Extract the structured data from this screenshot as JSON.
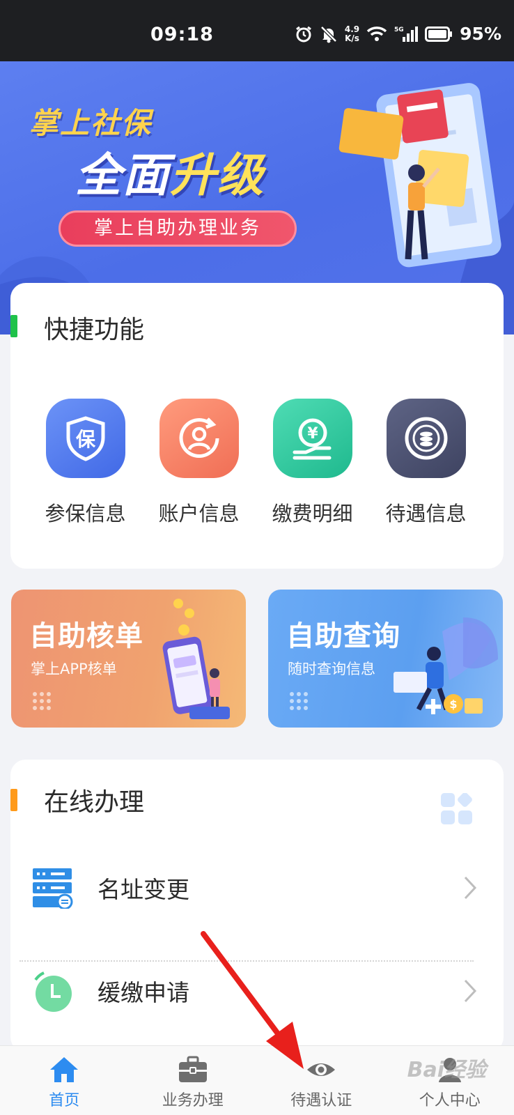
{
  "status_bar": {
    "time": "09:18",
    "net_speed_value": "4.9",
    "net_speed_unit": "K/s",
    "signal_type": "5G",
    "battery": "95%"
  },
  "banner": {
    "title_line1": "掌上社保",
    "title_line2_a": "全面",
    "title_line2_b": "升级",
    "pill": "掌上自助办理业务"
  },
  "quick": {
    "title": "快捷功能",
    "accent_color": "#1fc24a",
    "items": [
      {
        "label": "参保信息",
        "icon": "shield-bao-icon",
        "glyph": "保",
        "color": "#4f7cf0"
      },
      {
        "label": "账户信息",
        "icon": "account-refresh-icon",
        "color": "#f5866a"
      },
      {
        "label": "缴费明细",
        "icon": "yuan-hand-icon",
        "color": "#2fc8a0"
      },
      {
        "label": "待遇信息",
        "icon": "coin-stack-icon",
        "color": "#4a506e"
      }
    ]
  },
  "promos": {
    "left": {
      "title": "自助核单",
      "subtitle": "掌上APP核单",
      "color": "#ef9a72"
    },
    "right": {
      "title": "自助查询",
      "subtitle": "随时查询信息",
      "color": "#65a6f4"
    }
  },
  "online": {
    "title": "在线办理",
    "accent_color": "#ff9a1a",
    "items": [
      {
        "label": "名址变更",
        "icon": "address-change-icon"
      },
      {
        "label": "缓缴申请",
        "icon": "clock-icon"
      }
    ]
  },
  "tabs": [
    {
      "label": "首页",
      "icon": "home-icon",
      "active": true
    },
    {
      "label": "业务办理",
      "icon": "briefcase-icon",
      "active": false
    },
    {
      "label": "待遇认证",
      "icon": "eye-icon",
      "active": false
    },
    {
      "label": "个人中心",
      "icon": "person-icon",
      "active": false
    }
  ],
  "watermark": "Bai经验"
}
